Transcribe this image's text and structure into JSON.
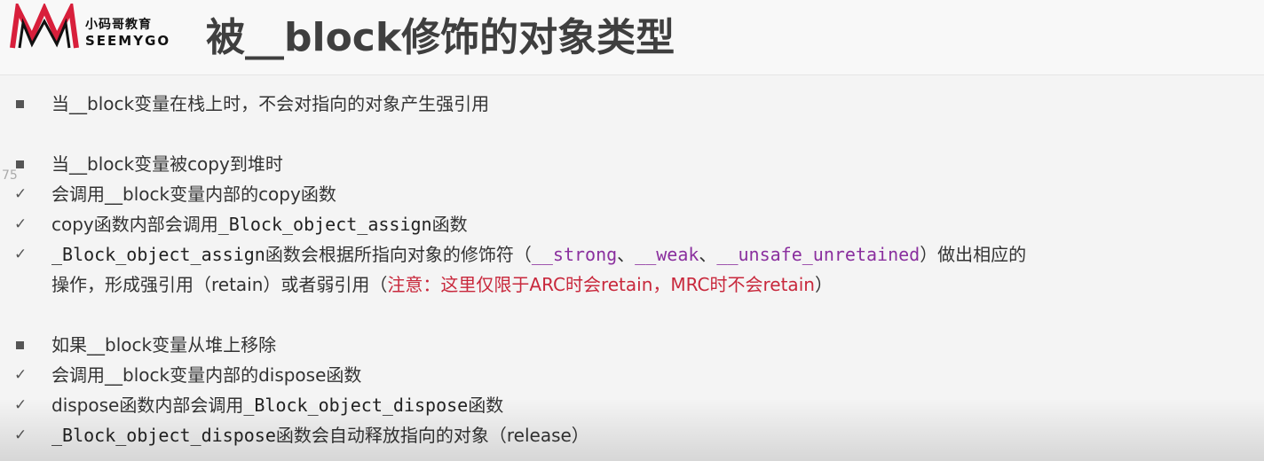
{
  "logo": {
    "cn": "小码哥教育",
    "en": "SEEMYGO"
  },
  "title": "被__block修饰的对象类型",
  "page_number": "75",
  "bullets": {
    "b1": "当__block变量在栈上时，不会对指向的对象产生强引用",
    "b2": "当__block变量被copy到堆时",
    "c1": "会调用__block变量内部的copy函数",
    "c2_pre": "copy函数内部会调用",
    "c2_code": "_Block_object_assign",
    "c2_post": "函数",
    "c3_code": "_Block_object_assign",
    "c3_mid": "函数会根据所指向对象的修饰符（",
    "c3_kw1": "__strong",
    "c3_sep1": "、",
    "c3_kw2": "__weak",
    "c3_sep2": "、",
    "c3_kw3": "__unsafe_unretained",
    "c3_end": "）做出相应的",
    "c3_cont": "操作，形成强引用（retain）或者弱引用（",
    "c3_note": "注意：这里仅限于ARC时会retain，MRC时不会retain",
    "c3_close": "）",
    "b3": "如果__block变量从堆上移除",
    "d1": "会调用__block变量内部的dispose函数",
    "d2_pre": "dispose函数内部会调用",
    "d2_code": "_Block_object_dispose",
    "d2_post": "函数",
    "d3_code": "_Block_object_dispose",
    "d3_post": "函数会自动释放指向的对象（release）"
  },
  "colors": {
    "keyword": "#8a2f9e",
    "note": "#c8283c",
    "logo_red": "#d81f3b"
  }
}
